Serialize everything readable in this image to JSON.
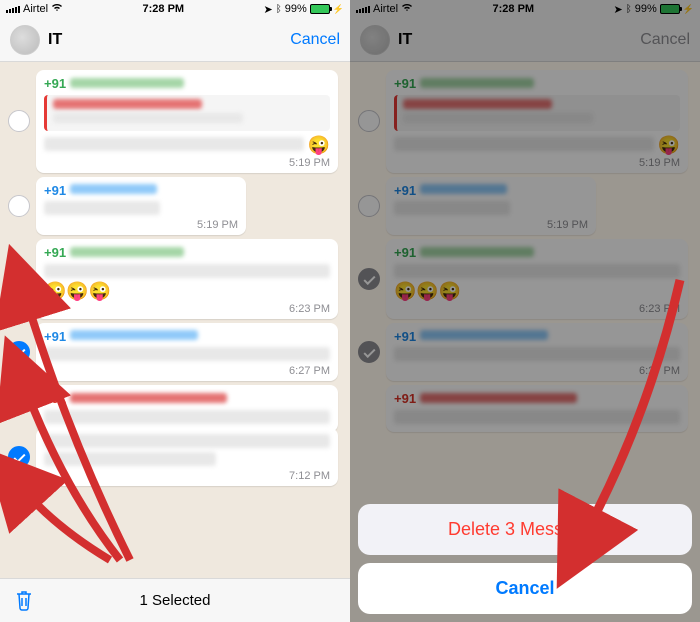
{
  "status": {
    "carrier": "Airtel",
    "time": "7:28 PM",
    "battery": "99%"
  },
  "nav": {
    "title": "IT",
    "cancel": "Cancel"
  },
  "senders": {
    "prefix_plus91": "+91"
  },
  "times": {
    "t1": "5:19 PM",
    "t2": "5:19 PM",
    "t3": "6:23 PM",
    "t4": "6:27 PM",
    "t5": "7:12 PM"
  },
  "emojis": {
    "single": "😜",
    "triple": "😜😜😜"
  },
  "toolbar": {
    "selected": "1 Selected"
  },
  "sheet": {
    "delete": "Delete 3 Messages",
    "cancel": "Cancel"
  }
}
